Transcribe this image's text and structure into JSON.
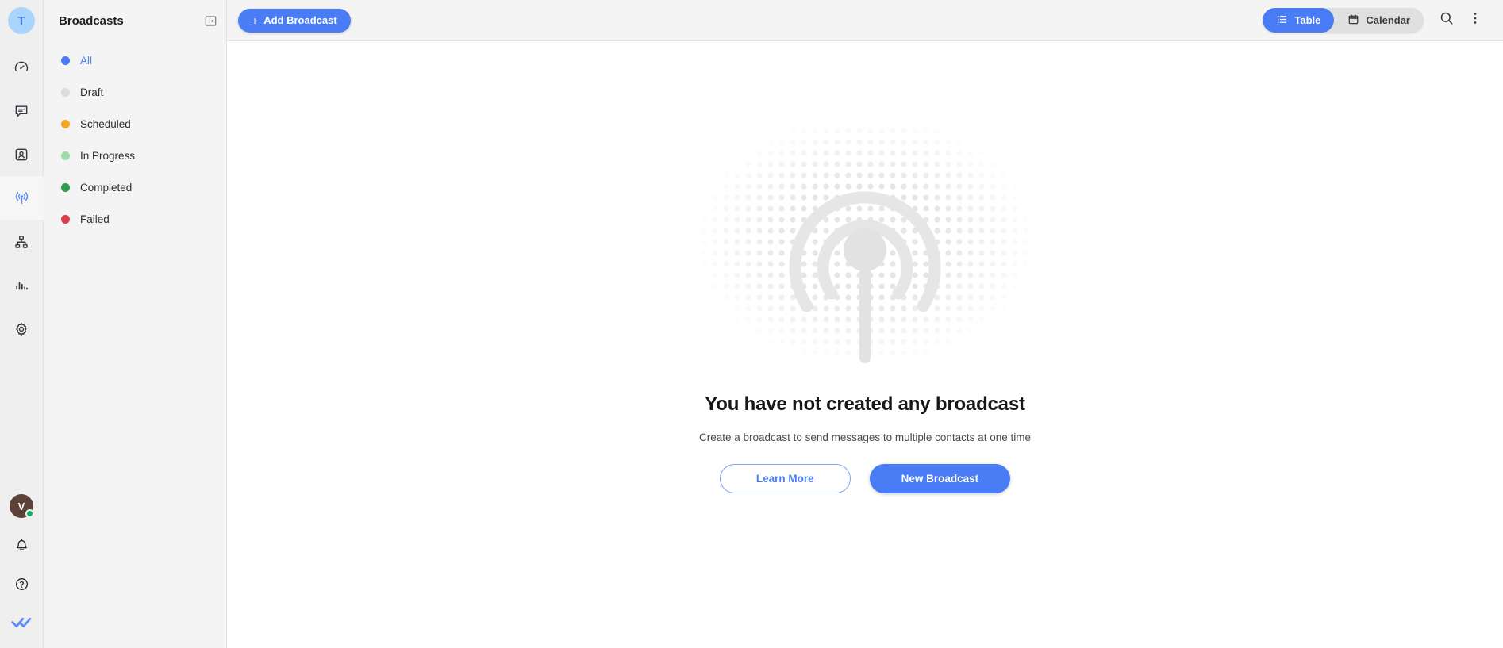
{
  "rail": {
    "workspace_avatar": {
      "initial": "T",
      "icon": "workspace-avatar"
    },
    "nav_items": [
      {
        "icon": "dashboard-icon",
        "name": "dashboard"
      },
      {
        "icon": "chat-icon",
        "name": "chat"
      },
      {
        "icon": "contacts-icon",
        "name": "contacts"
      },
      {
        "icon": "broadcast-icon",
        "name": "broadcast",
        "active": true
      },
      {
        "icon": "flow-icon",
        "name": "flow"
      },
      {
        "icon": "analytics-icon",
        "name": "analytics"
      },
      {
        "icon": "settings-icon",
        "name": "settings"
      }
    ],
    "user_avatar": {
      "initial": "V",
      "presence": "online"
    },
    "bottom_items": [
      {
        "icon": "bell-icon",
        "name": "notifications"
      },
      {
        "icon": "help-icon",
        "name": "help"
      },
      {
        "icon": "double-check-logo",
        "name": "app-logo"
      }
    ]
  },
  "panel": {
    "title": "Broadcasts",
    "collapse_icon": "panel-collapse-icon",
    "items": [
      {
        "label": "All",
        "color": "#4a7cf6",
        "active": true
      },
      {
        "label": "Draft",
        "color": "#dcdcdc",
        "active": false
      },
      {
        "label": "Scheduled",
        "color": "#f5a623",
        "active": false
      },
      {
        "label": "In Progress",
        "color": "#9ed9a8",
        "active": false
      },
      {
        "label": "Completed",
        "color": "#2e9e4f",
        "active": false
      },
      {
        "label": "Failed",
        "color": "#dc3d4a",
        "active": false
      }
    ]
  },
  "toolbar": {
    "add_broadcast_label": "Add Broadcast",
    "add_broadcast_plus": "+",
    "view_toggle": [
      {
        "label": "Table",
        "icon": "list-icon",
        "active": true
      },
      {
        "label": "Calendar",
        "icon": "calendar-icon",
        "active": false
      }
    ],
    "search_icon": "search-icon",
    "more_icon": "more-vertical-icon"
  },
  "empty_state": {
    "illustration": "broadcast-antenna-illustration",
    "title": "You have not created any broadcast",
    "subtitle": "Create a broadcast to send messages to multiple contacts at one time",
    "learn_more_label": "Learn More",
    "new_broadcast_label": "New Broadcast"
  },
  "colors": {
    "accent": "#4a7cf6",
    "rail_bg": "#efefef",
    "panel_bg": "#f4f4f4",
    "content_bg": "#ffffff",
    "illustration_gray": "#e8e8e8"
  }
}
